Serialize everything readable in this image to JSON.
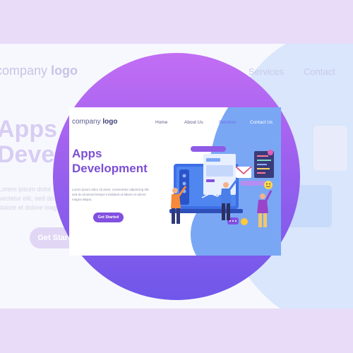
{
  "background": {
    "logo_light": "company",
    "logo_bold": "logo",
    "nav": [
      "Services",
      "Contact"
    ],
    "title_line1": "Apps",
    "title_line2": "Deve",
    "body_lines": [
      "Lorem ipsum dolor sit",
      "sectetur elit, sed do eiu",
      "dolore et dolore magna"
    ],
    "cta_label": "Get Started"
  },
  "page": {
    "logo_light": "company",
    "logo_bold": "logo",
    "nav": {
      "home": "Home",
      "about": "About Us",
      "services": "Services",
      "contact": "Contact Us"
    },
    "hero": {
      "title_line1": "Apps",
      "title_line2": "Development",
      "body": "Lorem ipsum dolor sit amet, consectetur adipiscing elit, sed do eiusmod tempor incididunt ut labore et dolore magna aliqua.",
      "cta_label": "Get Started"
    }
  },
  "colors": {
    "accent": "#8250e0",
    "title": "#7b4fd6",
    "band": "#e9dcf8",
    "blob": "#7aa7f4"
  }
}
